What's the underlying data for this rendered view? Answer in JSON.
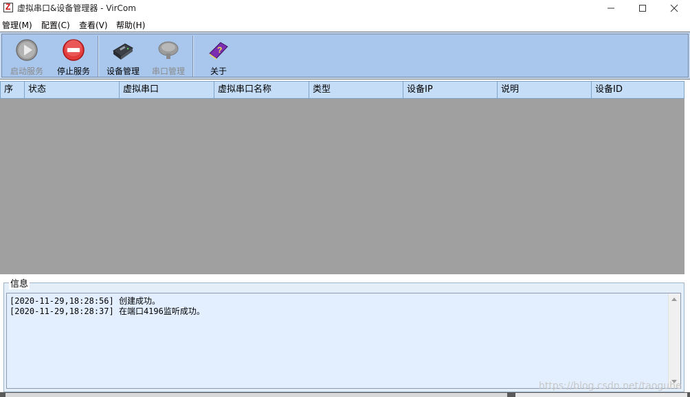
{
  "window": {
    "title": "虚拟串口&设备管理器 - VirCom",
    "app_icon_letter": "Z",
    "controls": {
      "minimize": "minimize-icon",
      "maximize": "maximize-icon",
      "close": "close-icon"
    }
  },
  "menu": {
    "items": [
      {
        "label": "管理(M)"
      },
      {
        "label": "配置(C)"
      },
      {
        "label": "查看(V)"
      },
      {
        "label": "帮助(H)"
      }
    ]
  },
  "toolbar": {
    "buttons": [
      {
        "label": "启动服务",
        "icon": "play-icon",
        "enabled": false
      },
      {
        "label": "停止服务",
        "icon": "stop-icon",
        "enabled": true
      },
      {
        "label": "设备管理",
        "icon": "device-icon",
        "enabled": true
      },
      {
        "label": "串口管理",
        "icon": "serial-port-icon",
        "enabled": false
      },
      {
        "label": "关于",
        "icon": "help-book-icon",
        "enabled": true
      }
    ]
  },
  "table": {
    "columns": [
      "序",
      "状态",
      "虚拟串口",
      "虚拟串口名称",
      "类型",
      "设备IP",
      "说明",
      "设备ID"
    ],
    "rows": []
  },
  "info": {
    "title": "信息",
    "log": [
      "[2020-11-29,18:28:56] 创建成功。",
      "[2020-11-29,18:28:37] 在端口4196监听成功。"
    ]
  },
  "watermark": "https://blog.csdn.net/taoguhe",
  "colors": {
    "toolbar_bg": "#a9c7ec",
    "header_bg": "#c5ddf6",
    "grid_bg": "#a0a0a0",
    "log_bg": "#e3efff"
  }
}
